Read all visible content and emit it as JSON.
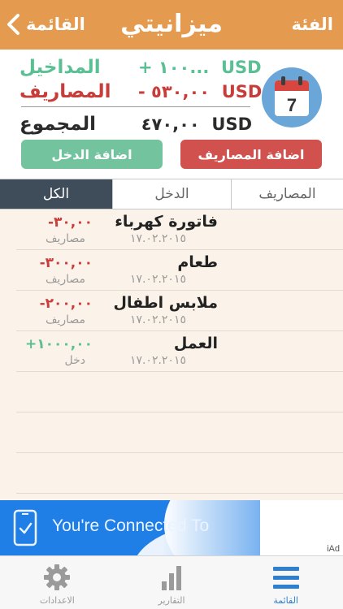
{
  "navbar": {
    "back_label": "القائمة",
    "title": "ميزانيتي",
    "category_label": "الفئة"
  },
  "summary": {
    "income": {
      "label": "المداخيل",
      "value": "+ ١٠٠...",
      "currency": "USD",
      "color": "#5bbf94"
    },
    "expenses": {
      "label": "المصاريف",
      "value": "- ٥٣٠,٠٠",
      "currency": "USD",
      "color": "#c83c3a"
    },
    "total": {
      "label": "المجموع",
      "value": "٤٧٠,٠٠",
      "currency": "USD"
    },
    "calendar_day": "7"
  },
  "buttons": {
    "add_income": "اضافة الدخل",
    "add_expense": "اضافة المصاريف"
  },
  "tabs": [
    {
      "label": "الكل",
      "active": true
    },
    {
      "label": "الدخل",
      "active": false
    },
    {
      "label": "المصاريف",
      "active": false
    }
  ],
  "transactions": [
    {
      "name": "فاتورة كهرباء",
      "date": "١٧.٠٢.٢٠١٥",
      "amount": "-٣٠,٠٠",
      "type": "مصاريف",
      "kind": "expense"
    },
    {
      "name": "طعام",
      "date": "١٧.٠٢.٢٠١٥",
      "amount": "-٣٠٠,٠٠",
      "type": "مصاريف",
      "kind": "expense"
    },
    {
      "name": "ملابس اطفال",
      "date": "١٧.٠٢.٢٠١٥",
      "amount": "-٢٠٠,٠٠",
      "type": "مصاريف",
      "kind": "expense"
    },
    {
      "name": "العمل",
      "date": "١٧.٠٢.٢٠١٥",
      "amount": "+١٠٠٠,٠٠",
      "type": "دخل",
      "kind": "income"
    }
  ],
  "ad": {
    "text": "You're Connected To",
    "label": "iAd"
  },
  "tabbar": [
    {
      "label": "القائمة",
      "icon": "list-icon",
      "active": true
    },
    {
      "label": "التقارير",
      "icon": "bar-chart-icon",
      "active": false
    },
    {
      "label": "الاعدادات",
      "icon": "gear-icon",
      "active": false
    }
  ],
  "colors": {
    "navbar": "#e49a4f",
    "income": "#5bbf94",
    "expense": "#c83c3a",
    "active_tab": "#3f4d5a",
    "tabbar_active": "#2f7fd0"
  }
}
